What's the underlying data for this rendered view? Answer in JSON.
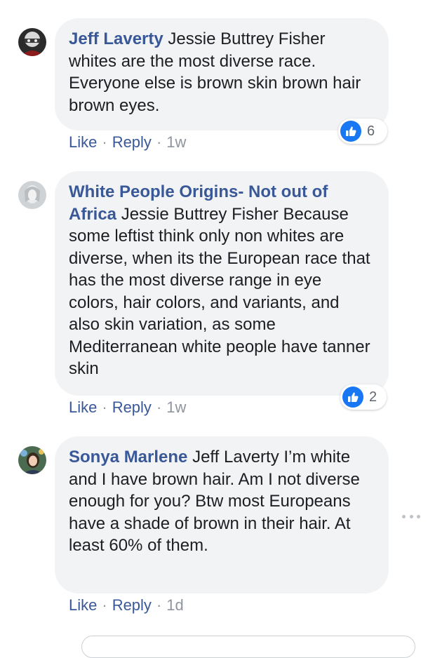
{
  "comments": [
    {
      "author": "Jeff Laverty",
      "text": " Jessie Buttrey Fisher whites are the most diverse race. Everyone else is brown skin brown hair brown eyes.",
      "like_label": "Like",
      "reply_label": "Reply",
      "time": "1w",
      "reaction_count": "6"
    },
    {
      "author": "White People Origins- Not out of Africa",
      "text": " Jessie Buttrey Fisher Because some leftist think only non whites are diverse, when its the European race that has the most diverse range in eye colors, hair colors, and variants, and also skin variation, as some Mediterranean white people have tanner skin",
      "like_label": "Like",
      "reply_label": "Reply",
      "time": "1w",
      "reaction_count": "2"
    },
    {
      "author": "Sonya Marlene",
      "text": " Jeff Laverty I’m white and I have brown hair. Am I not diverse enough for you? Btw most Europeans have a shade of brown in their hair. At least 60% of them.",
      "like_label": "Like",
      "reply_label": "Reply",
      "time": "1d"
    }
  ],
  "separator": "·",
  "icons": {
    "reaction": "thumbs-up-icon",
    "more": "more-options-icon"
  },
  "colors": {
    "author": "#385898",
    "bubble": "#f2f3f5",
    "like_reaction": "#1877f2",
    "meta": "#90949c"
  }
}
